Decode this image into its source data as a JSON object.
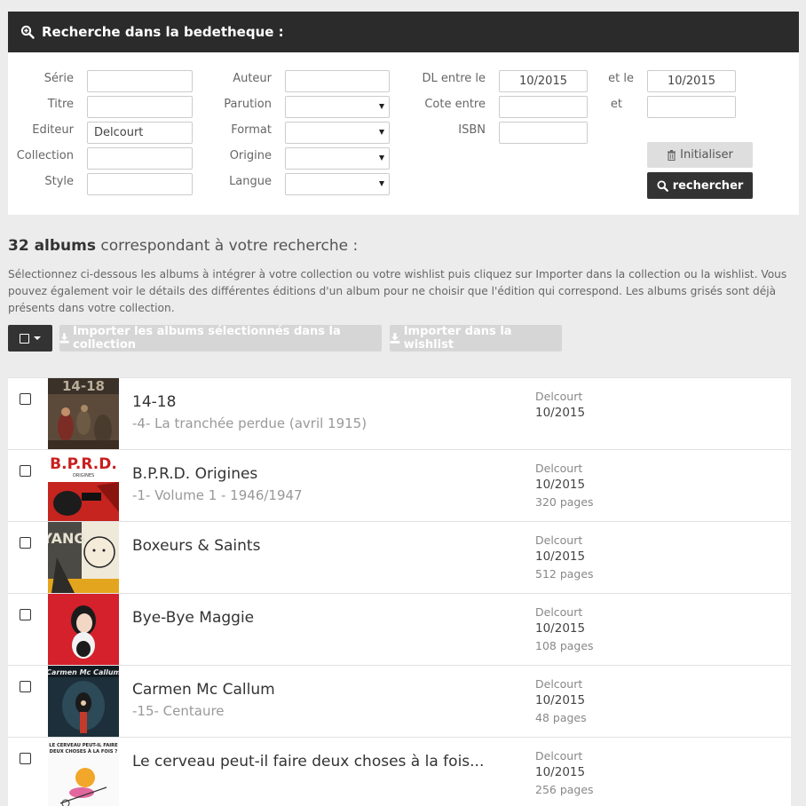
{
  "search": {
    "title": "Recherche dans la bedetheque :",
    "labels": {
      "serie": "Série",
      "titre": "Titre",
      "editeur": "Editeur",
      "collection": "Collection",
      "style": "Style",
      "auteur": "Auteur",
      "parution": "Parution",
      "format": "Format",
      "origine": "Origine",
      "langue": "Langue",
      "dl_entre": "DL entre le",
      "et_le": "et le",
      "cote_entre": "Cote entre",
      "et": "et",
      "isbn": "ISBN"
    },
    "values": {
      "serie": "",
      "titre": "",
      "editeur": "Delcourt",
      "collection": "",
      "style": "",
      "auteur": "",
      "dl_from": "10/2015",
      "dl_to": "10/2015",
      "cote_from": "",
      "cote_to": "",
      "isbn": ""
    },
    "reset_label": "Initialiser",
    "search_label": "rechercher"
  },
  "results": {
    "count": "32 albums",
    "heading_suffix": " correspondant à votre recherche :",
    "description": "Sélectionnez ci-dessous les albums à intégrer à votre collection ou votre wishlist puis cliquez sur Importer dans la collection ou la wishlist. Vous pouvez également voir le détails des différentes éditions d'un album pour ne choisir que l'édition qui correspond. Les albums grisés sont déjà présents dans votre collection.",
    "import_collection_label": "Importer les albums sélectionnés dans la collection",
    "import_wishlist_label": "Importer dans la wishlist"
  },
  "albums": [
    {
      "title": "14-18",
      "subtitle": "-4- La tranchée perdue (avril 1915)",
      "publisher": "Delcourt",
      "date": "10/2015",
      "pages": ""
    },
    {
      "title": "B.P.R.D. Origines",
      "subtitle": "-1- Volume 1 - 1946/1947",
      "publisher": "Delcourt",
      "date": "10/2015",
      "pages": "320 pages"
    },
    {
      "title": "Boxeurs & Saints",
      "subtitle": "",
      "publisher": "Delcourt",
      "date": "10/2015",
      "pages": "512 pages"
    },
    {
      "title": "Bye-Bye Maggie",
      "subtitle": "",
      "publisher": "Delcourt",
      "date": "10/2015",
      "pages": "108 pages"
    },
    {
      "title": "Carmen Mc Callum",
      "subtitle": "-15- Centaure",
      "publisher": "Delcourt",
      "date": "10/2015",
      "pages": "48 pages"
    },
    {
      "title": "Le cerveau peut-il faire deux choses à la fois...",
      "subtitle": "",
      "publisher": "Delcourt",
      "date": "10/2015",
      "pages": "256 pages"
    }
  ],
  "covers": {
    "c1": "14-18",
    "c2": "B.P.R.D.",
    "c2b": "ORIGINES",
    "c3": "YANG",
    "c5": "Carmen Mc Callum",
    "c6a": "LE CERVEAU PEUT-IL FAIRE",
    "c6b": "DEUX CHOSES À LA FOIS ?"
  },
  "icons": {
    "search_header": "search-plus-icon",
    "reset": "trash-icon",
    "search": "magnifier-icon",
    "import": "download-icon",
    "select_all": "checkbox-icon",
    "dropdown": "caret-down-icon"
  },
  "colors": {
    "header_bg": "#2b2b2b",
    "page_bg": "#ececec",
    "primary_button": "#333333",
    "disabled_button": "#d6d6d6"
  }
}
